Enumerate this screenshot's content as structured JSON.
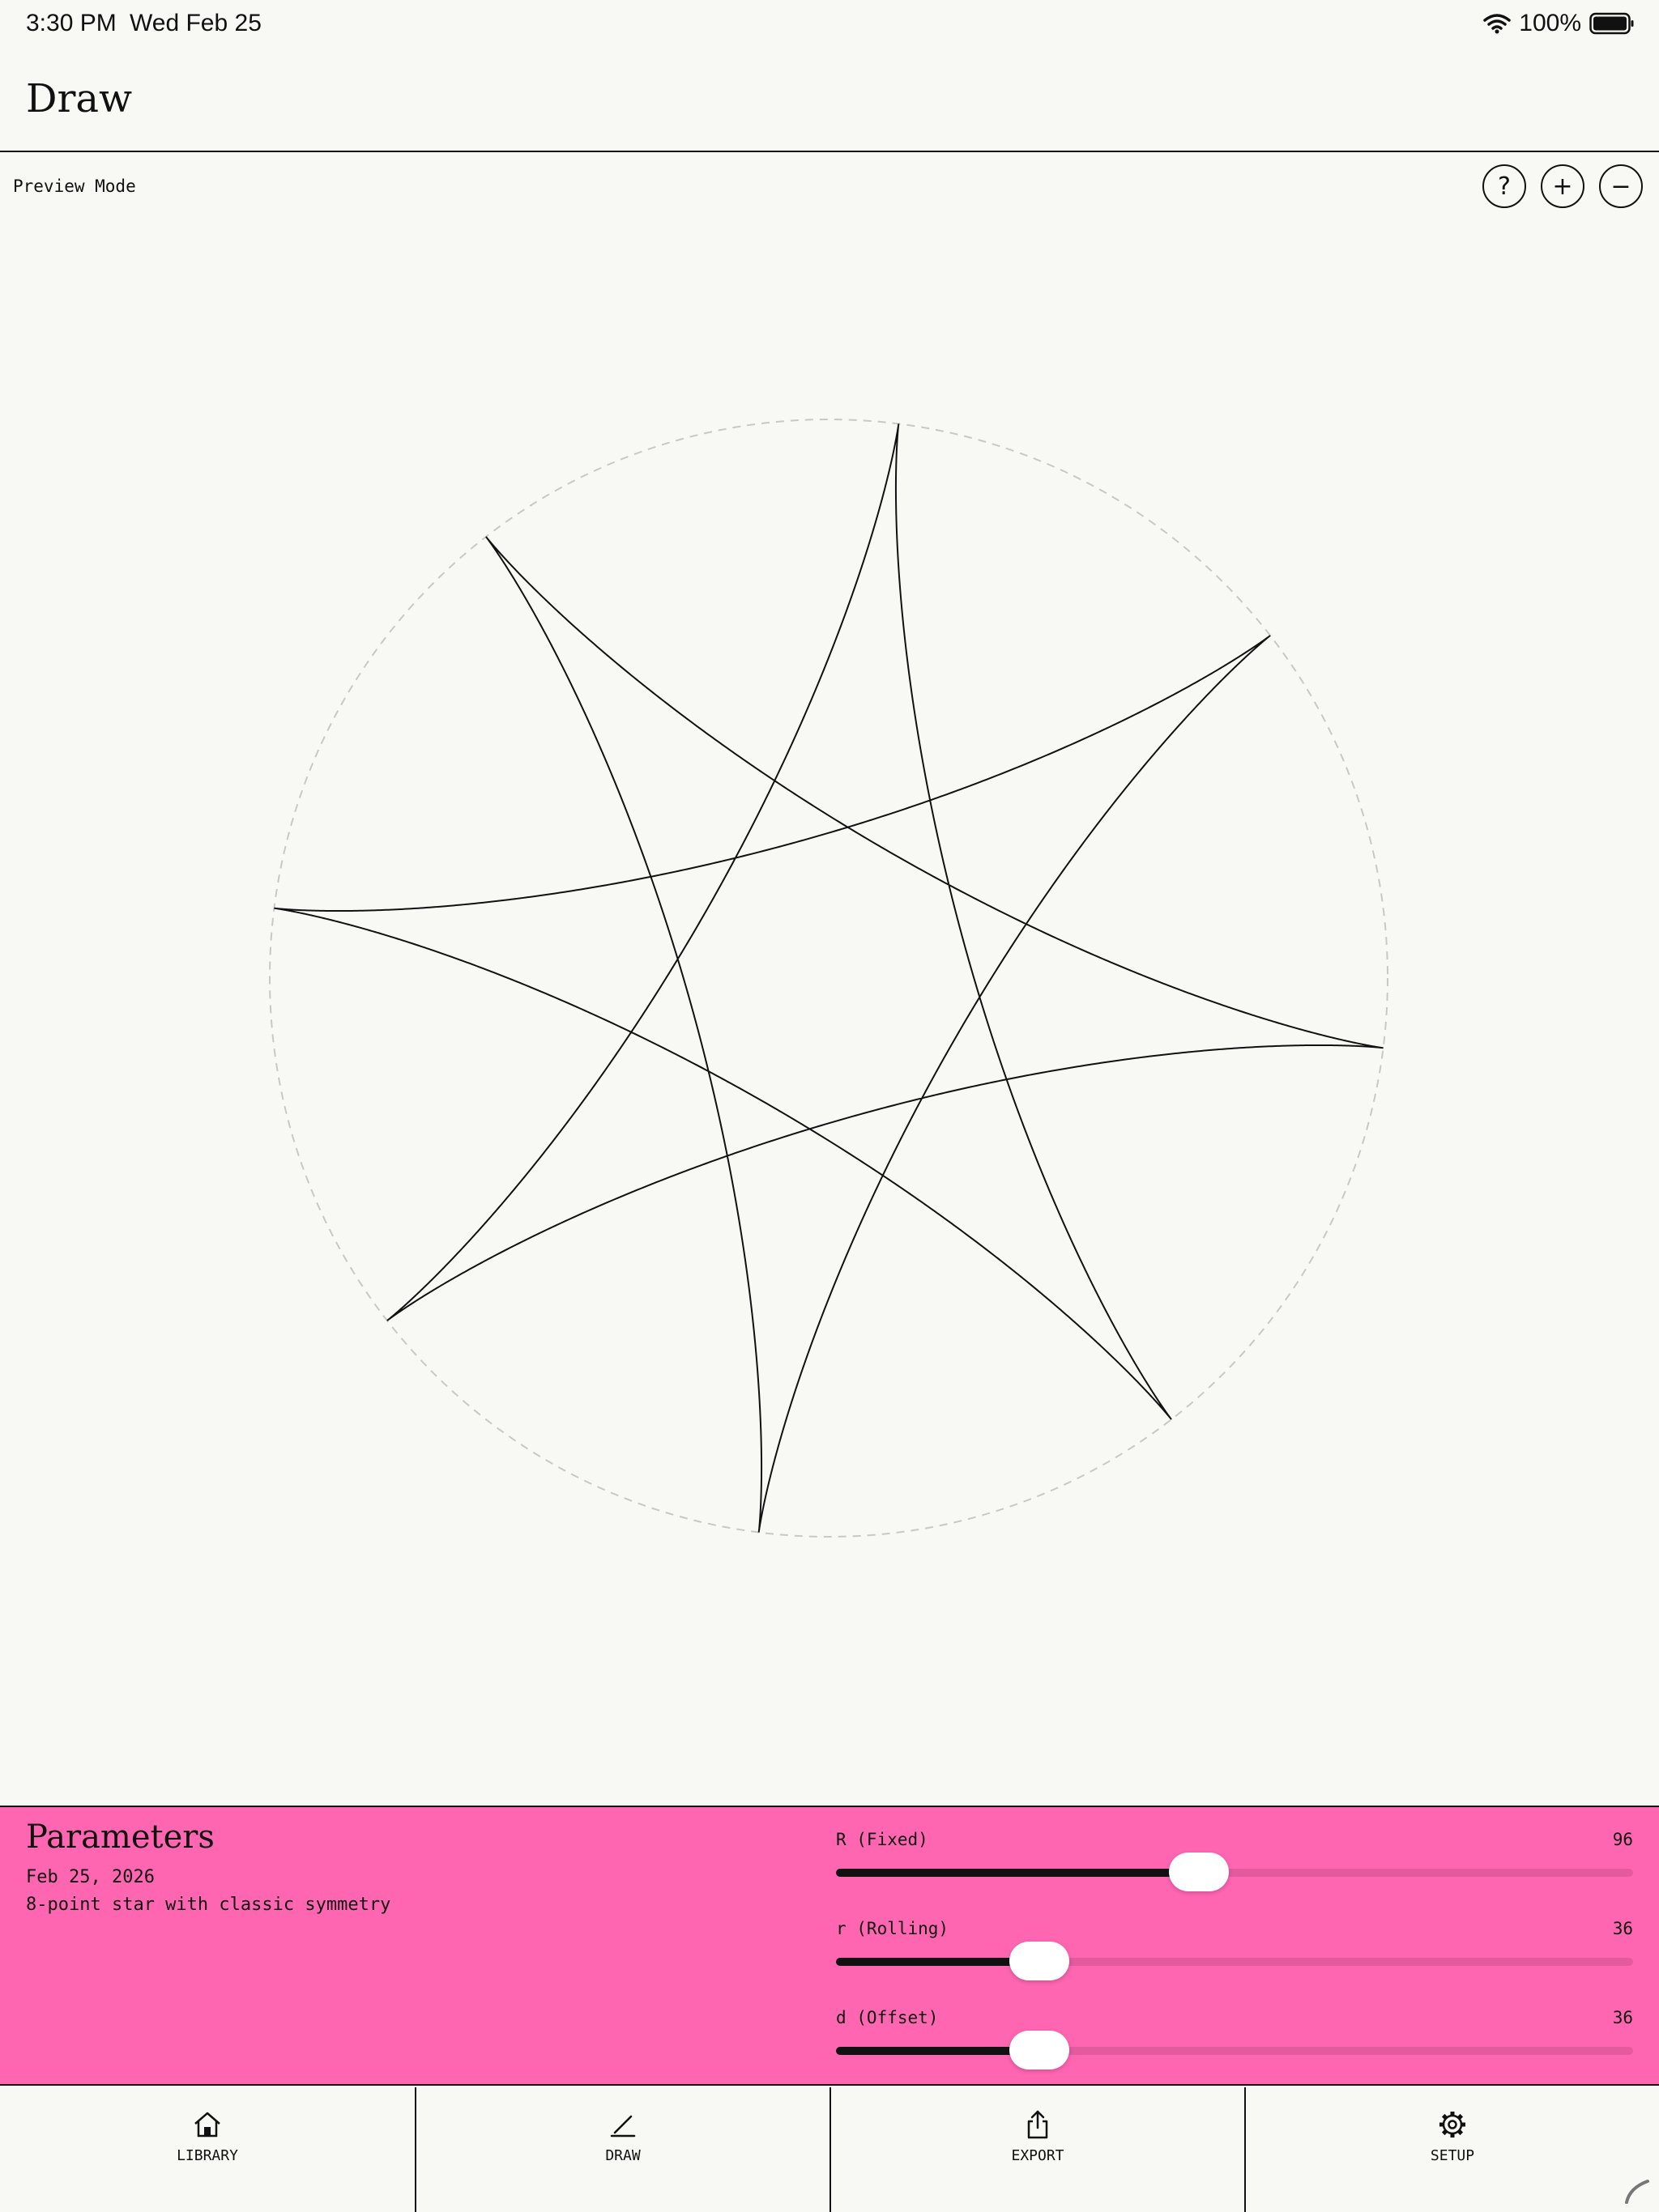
{
  "status_bar": {
    "time": "3:30 PM",
    "date": "Wed Feb 25",
    "battery": "100%"
  },
  "header": {
    "title": "Draw"
  },
  "canvas": {
    "mode": "Preview Mode",
    "help_label": "?",
    "zoom_in_label": "+",
    "zoom_out_label": "−",
    "pattern": {
      "R": 96,
      "r": 36,
      "d": 36
    }
  },
  "parameters": {
    "title": "Parameters",
    "date": "Feb 25, 2026",
    "description": "8-point star with classic symmetry",
    "sliders": [
      {
        "label": "R (Fixed)",
        "value": "96",
        "fraction": 0.455
      },
      {
        "label": "r (Rolling)",
        "value": "36",
        "fraction": 0.255
      },
      {
        "label": "d (Offset)",
        "value": "36",
        "fraction": 0.255
      }
    ]
  },
  "tabs": [
    {
      "label": "LIBRARY",
      "icon": "home-icon"
    },
    {
      "label": "DRAW",
      "icon": "pen-icon"
    },
    {
      "label": "EXPORT",
      "icon": "share-icon"
    },
    {
      "label": "SETUP",
      "icon": "gear-icon"
    }
  ],
  "colors": {
    "background": "#f8f8f4",
    "panel": "#ff66b2",
    "track": "#e35a9e",
    "ink": "#111111"
  }
}
